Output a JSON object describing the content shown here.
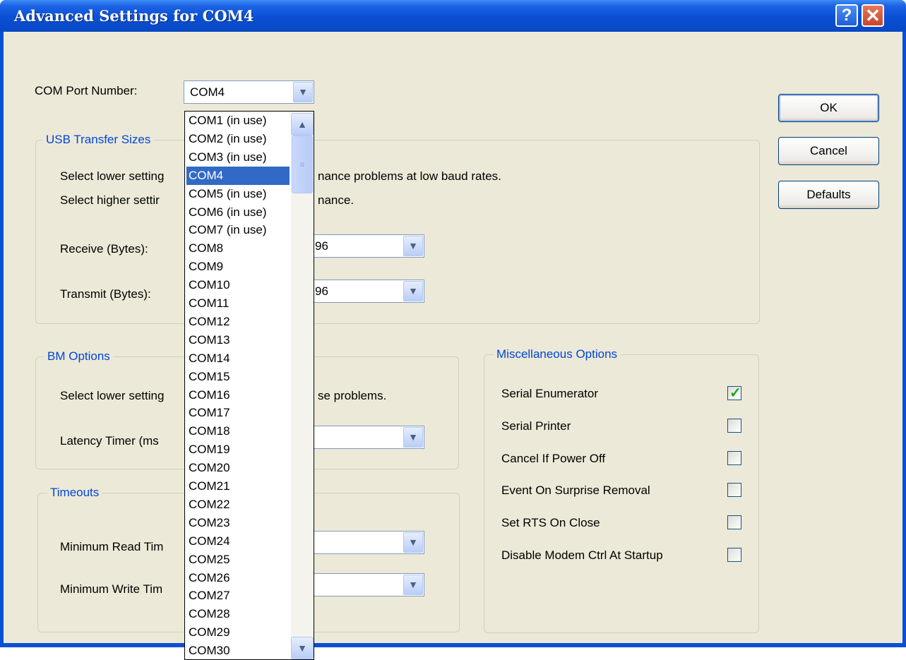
{
  "window": {
    "title": "Advanced Settings for COM4",
    "help_glyph": "?",
    "close_glyph": "✕"
  },
  "com_port": {
    "label": "COM Port Number:",
    "selected": "COM4",
    "options": [
      "COM1 (in use)",
      "COM2 (in use)",
      "COM3 (in use)",
      "COM4",
      "COM5 (in use)",
      "COM6 (in use)",
      "COM7 (in use)",
      "COM8",
      "COM9",
      "COM10",
      "COM11",
      "COM12",
      "COM13",
      "COM14",
      "COM15",
      "COM16",
      "COM17",
      "COM18",
      "COM19",
      "COM20",
      "COM21",
      "COM22",
      "COM23",
      "COM24",
      "COM25",
      "COM26",
      "COM27",
      "COM28",
      "COM29",
      "COM30"
    ],
    "selected_index": 3
  },
  "usb": {
    "title": "USB Transfer Sizes",
    "line1_start": "Select lower setting",
    "line1_end": "nance problems at low baud rates.",
    "line2_start": "Select higher settir",
    "line2_end": "nance.",
    "receive_label": "Receive (Bytes):",
    "receive_value": "96",
    "transmit_label": "Transmit (Bytes):",
    "transmit_value": "96"
  },
  "bm": {
    "title": "BM Options",
    "desc_start": "Select lower setting",
    "desc_end": "se problems.",
    "latency_label": "Latency Timer (ms"
  },
  "timeouts": {
    "title": "Timeouts",
    "read_label": "Minimum Read Tim",
    "write_label": "Minimum Write Tim"
  },
  "misc": {
    "title": "Miscellaneous Options",
    "options": [
      {
        "label": "Serial Enumerator",
        "checked": true
      },
      {
        "label": "Serial Printer",
        "checked": false
      },
      {
        "label": "Cancel If Power Off",
        "checked": false
      },
      {
        "label": "Event On Surprise Removal",
        "checked": false
      },
      {
        "label": "Set RTS On Close",
        "checked": false
      },
      {
        "label": "Disable Modem Ctrl At Startup",
        "checked": false
      }
    ]
  },
  "buttons": {
    "ok": "OK",
    "cancel": "Cancel",
    "defaults": "Defaults"
  },
  "icons": {
    "combo_arrow": "chevron-down-icon",
    "scroll_up": "chevron-up-icon",
    "scroll_down": "chevron-down-icon",
    "check": "checkmark-icon"
  },
  "colors": {
    "titlebar": "#0a4fd4",
    "dialog_bg": "#ece9d8",
    "group_title": "#0046d5",
    "selection": "#316ac5",
    "checkmark": "#21a121"
  }
}
